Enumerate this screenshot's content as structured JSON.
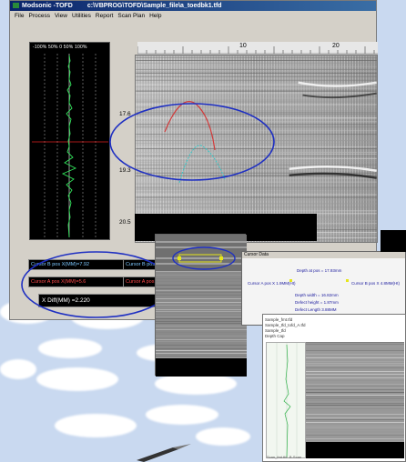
{
  "app": {
    "title": "Modsonic -TOFD",
    "file_path": "c:\\VBPROG\\TOFD\\Sample_file\\a_toedbk1.tfd"
  },
  "menu": [
    "File",
    "Process",
    "View",
    "Utilities",
    "Report",
    "Scan Plan",
    "Help"
  ],
  "ascan": {
    "tick_labels": "-100% 50%   0   50%  100%"
  },
  "bscan": {
    "x_ticks": [
      "10",
      "20"
    ],
    "depth_labels": [
      "17.6",
      "19.3",
      "20.5"
    ]
  },
  "cursors": {
    "cursor_b_pos": "Cursor B pos X(MM)=7.92",
    "cursor_b_right": "Cursor B pos",
    "cursor_a_pos": "Cursor A pos X(MM)=5.6",
    "cursor_a_right": "Cursor A pos",
    "x_diff": "X Diff(MM) =2.220"
  },
  "cursor_dialog": {
    "title": "Cursor Data",
    "rows": [
      "Depth at pos = 17.93mm",
      "Cursor A pos X 1.9MM(Ht)",
      "Cursor B pos X 4.8MM(Ht)",
      "Depth width = 16.82mm",
      "Defect height = 1.87mm",
      "Defect Length 3.88MM"
    ]
  },
  "detail_window": {
    "header_lines": [
      "Sample_fmt.tfd",
      "Sample_tfd_tofd_A.tfd",
      "Sample_tfd",
      "Depth  Cap"
    ],
    "footer": "Scan_fmt.tfd  -B-Scan"
  },
  "colors": {
    "titlebar": "#0a246a",
    "highlight_ellipse": "#1e2fc2",
    "defect_red": "#d23a3a",
    "defect_cyan": "#2fc8c8",
    "ascan_trace": "#31e25a",
    "cursor_marker": "#e6e61a"
  }
}
